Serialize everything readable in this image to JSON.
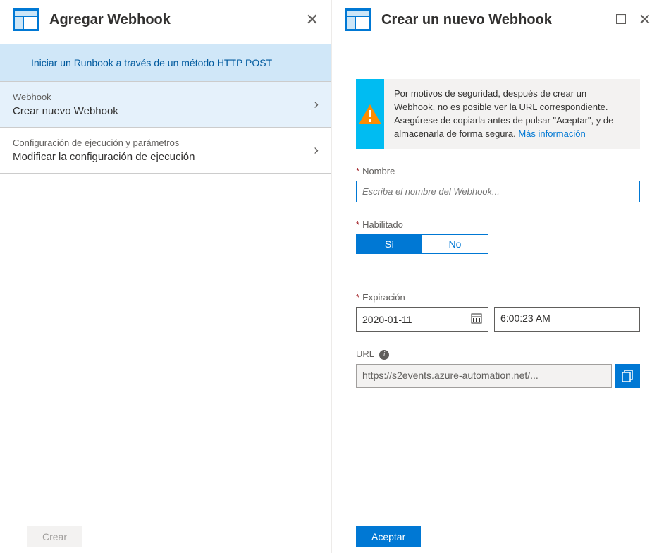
{
  "left": {
    "title": "Agregar Webhook",
    "subtitle": "Iniciar un Runbook a través de un método HTTP POST",
    "items": [
      {
        "label": "Webhook",
        "value": "Crear nuevo Webhook"
      },
      {
        "label": "Configuración de ejecución y parámetros",
        "value": "Modificar la configuración de ejecución"
      }
    ],
    "create_label": "Crear"
  },
  "right": {
    "title": "Crear un nuevo Webhook",
    "info_text": "Por motivos de seguridad, después de crear un Webhook, no es posible ver la URL correspondiente. Asegúrese de copiarla antes de pulsar \"Aceptar\", y de almacenarla de forma segura. ",
    "info_link": "Más información",
    "name_label": "Nombre",
    "name_placeholder": "Escriba el nombre del Webhook...",
    "enabled_label": "Habilitado",
    "enabled_yes": "Sí",
    "enabled_no": "No",
    "expiration_label": "Expiración",
    "expiration_date": "2020-01-11",
    "expiration_time": "6:00:23 AM",
    "url_label": "URL",
    "url_value": "https://s2events.azure-automation.net/...",
    "accept_label": "Aceptar"
  }
}
